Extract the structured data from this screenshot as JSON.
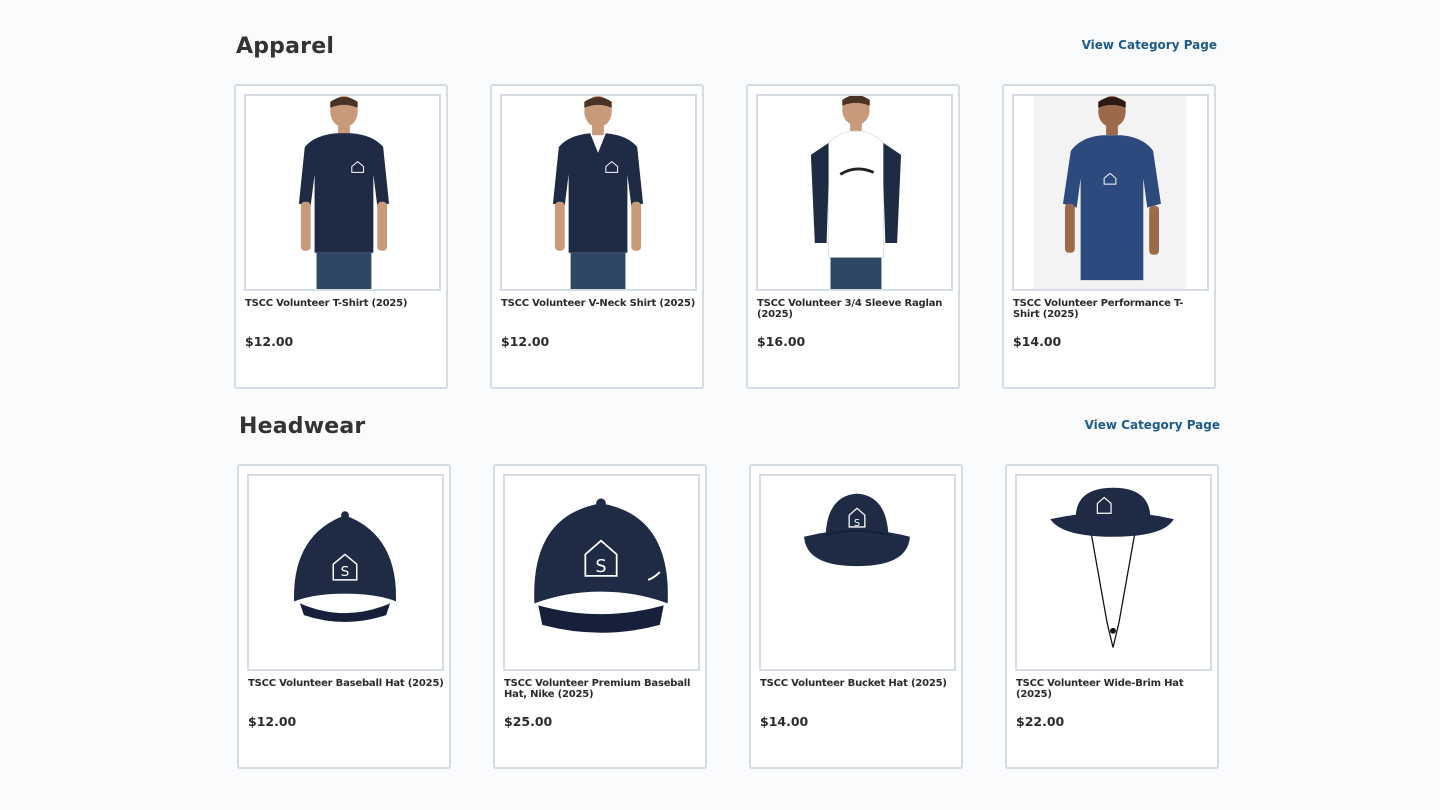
{
  "sections": [
    {
      "title": "Apparel",
      "link_label": "View Category Page",
      "products": [
        {
          "name": "TSCC Volunteer T-Shirt (2025)",
          "price": "$12.00",
          "image": "tshirt-photo"
        },
        {
          "name": "TSCC Volunteer V-Neck Shirt (2025)",
          "price": "$12.00",
          "image": "vneck-photo"
        },
        {
          "name": "TSCC Volunteer 3/4 Sleeve Raglan (2025)",
          "price": "$16.00",
          "image": "raglan-photo"
        },
        {
          "name": "TSCC Volunteer Performance T-Shirt (2025)",
          "price": "$14.00",
          "image": "performance-tshirt-photo"
        }
      ]
    },
    {
      "title": "Headwear",
      "link_label": "View Category Page",
      "products": [
        {
          "name": "TSCC Volunteer Baseball Hat (2025)",
          "price": "$12.00",
          "image": "baseball-hat-photo"
        },
        {
          "name": "TSCC Volunteer Premium Baseball Hat, Nike (2025)",
          "price": "$25.00",
          "image": "premium-hat-photo"
        },
        {
          "name": "TSCC Volunteer Bucket Hat (2025)",
          "price": "$14.00",
          "image": "bucket-hat-photo"
        },
        {
          "name": "TSCC Volunteer Wide-Brim Hat (2025)",
          "price": "$22.00",
          "image": "wide-brim-hat-photo"
        }
      ]
    }
  ],
  "colors": {
    "navy": "#1f2a44",
    "link": "#1e5a8a",
    "card_border": "#d5dce6",
    "background": "#fafbfc"
  }
}
